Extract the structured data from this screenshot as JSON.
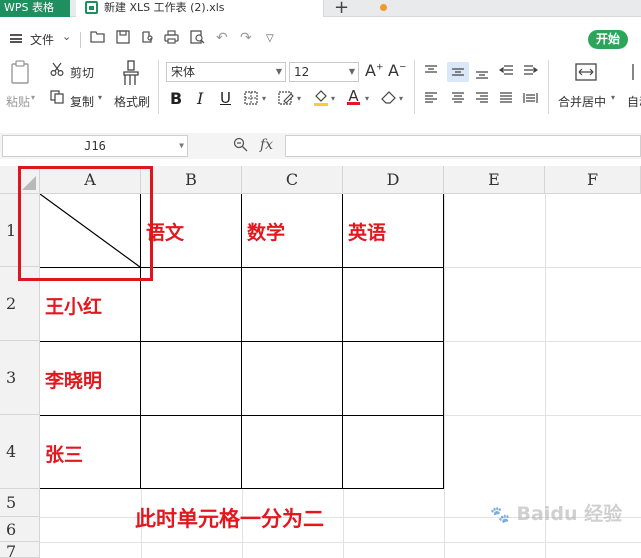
{
  "titlebar": {
    "app_tab": "WPS 表格",
    "doc_tab": "新建 XLS 工作表 (2).xls",
    "new_tab": "+"
  },
  "menu": {
    "file": "文件",
    "start_button": "开始"
  },
  "ribbon": {
    "paste": "粘贴",
    "cut": "剪切",
    "copy": "复制",
    "format_painter": "格式刷",
    "font_name": "宋体",
    "font_size": "12",
    "bold": "B",
    "italic": "I",
    "underline": "U",
    "merge_center": "合并居中",
    "auto_wrap": "自动"
  },
  "formula_bar": {
    "name_box": "J16",
    "fx": "fx",
    "formula": ""
  },
  "sheet": {
    "columns": [
      "A",
      "B",
      "C",
      "D",
      "E",
      "F"
    ],
    "rows": [
      "1",
      "2",
      "3",
      "4",
      "5",
      "6",
      "7"
    ],
    "header_row": [
      "语文",
      "数学",
      "英语"
    ],
    "names": [
      "王小红",
      "李晓明",
      "张三"
    ],
    "note": "此时单元格一分为二",
    "watermark": "Baidu 经验"
  },
  "colors": {
    "brand_green": "#1f8f5f",
    "start_green": "#2aa55a",
    "cell_text_red": "#e3171e",
    "highlight_red": "#e0141c",
    "unsaved_orange": "#f09a32"
  },
  "icons": [
    "menu-icon",
    "folder-icon",
    "save-icon",
    "print-icon",
    "undo-icon",
    "redo-icon",
    "zoom-icon",
    "fill-color-icon",
    "font-color-icon",
    "eraser-icon",
    "paw-icon"
  ]
}
